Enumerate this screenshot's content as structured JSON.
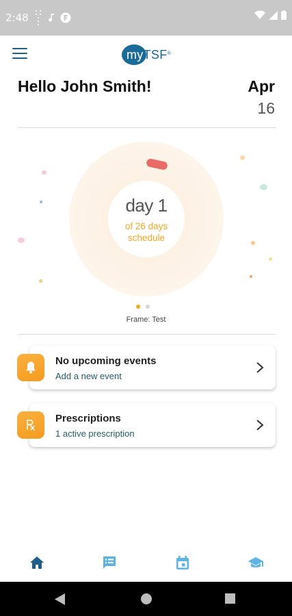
{
  "status_bar": {
    "time": "2:48",
    "left_icons": [
      "signal-dots-icon",
      "music-note-icon",
      "app-notification-icon"
    ],
    "right_icons": [
      "wifi-icon",
      "cell-signal-icon",
      "battery-icon"
    ]
  },
  "header": {
    "menu_icon": "hamburger-menu-icon",
    "logo": {
      "my": "my",
      "tsf": "TSF",
      "mark": "®"
    }
  },
  "greeting": "Hello John Smith!",
  "date": {
    "month": "Apr",
    "day": "16"
  },
  "progress": {
    "day_label": "day 1",
    "sub_line1": "of 26 days",
    "sub_line2": "schedule",
    "frame_label": "Frame: Test",
    "pager_active": 0,
    "pager_count": 2
  },
  "cards": [
    {
      "icon": "bell-icon",
      "title": "No upcoming events",
      "subtitle": "Add a new event"
    },
    {
      "icon": "prescription-icon",
      "title": "Prescriptions",
      "subtitle": "1 active prescription"
    }
  ],
  "bottom_nav": [
    {
      "icon": "home-icon",
      "active": true
    },
    {
      "icon": "chat-list-icon",
      "active": false
    },
    {
      "icon": "calendar-icon",
      "active": false
    },
    {
      "icon": "education-cap-icon",
      "active": false
    }
  ],
  "colors": {
    "brand_blue": "#1b6b98",
    "accent_orange": "#f5a623",
    "nav_active": "#1d5f8a",
    "nav_inactive": "#5fb4e3",
    "pill_red": "#ea6b65"
  }
}
